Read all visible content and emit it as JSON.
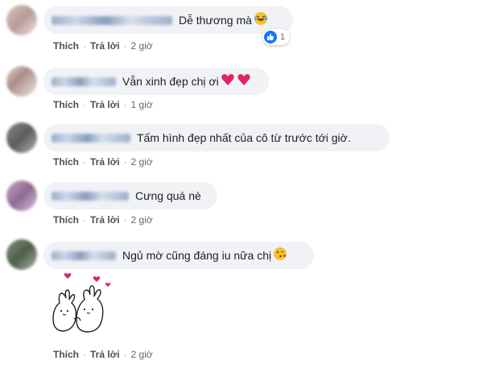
{
  "comments": [
    {
      "text": "Dễ thương mà",
      "emoji": "laughing-tears-emoji",
      "like": "Thích",
      "reply": "Trả lời",
      "time": "2 giờ",
      "reaction_count": "1"
    },
    {
      "text": "Vẫn xinh đẹp chị ơi",
      "emoji": "red-hearts-emoji",
      "like": "Thích",
      "reply": "Trả lời",
      "time": "1 giờ"
    },
    {
      "text": "Tấm hình đẹp nhất của cô từ trước tới giờ.",
      "like": "Thích",
      "reply": "Trả lời",
      "time": "2 giờ"
    },
    {
      "text": "Cưng quá nè",
      "like": "Thích",
      "reply": "Trả lời",
      "time": "2 giờ"
    },
    {
      "text": "Ngủ mờ cũng đáng iu nữa chị",
      "emoji": "kissing-face-emoji",
      "like": "Thích",
      "reply": "Trả lời",
      "time": "2 giờ",
      "sticker": "bunny-hearts-sticker"
    }
  ],
  "colors": {
    "bubble": "#f0f2f5",
    "like_blue": "#1877f2",
    "action_text": "#4b4f56",
    "heart": "#e0245e"
  }
}
